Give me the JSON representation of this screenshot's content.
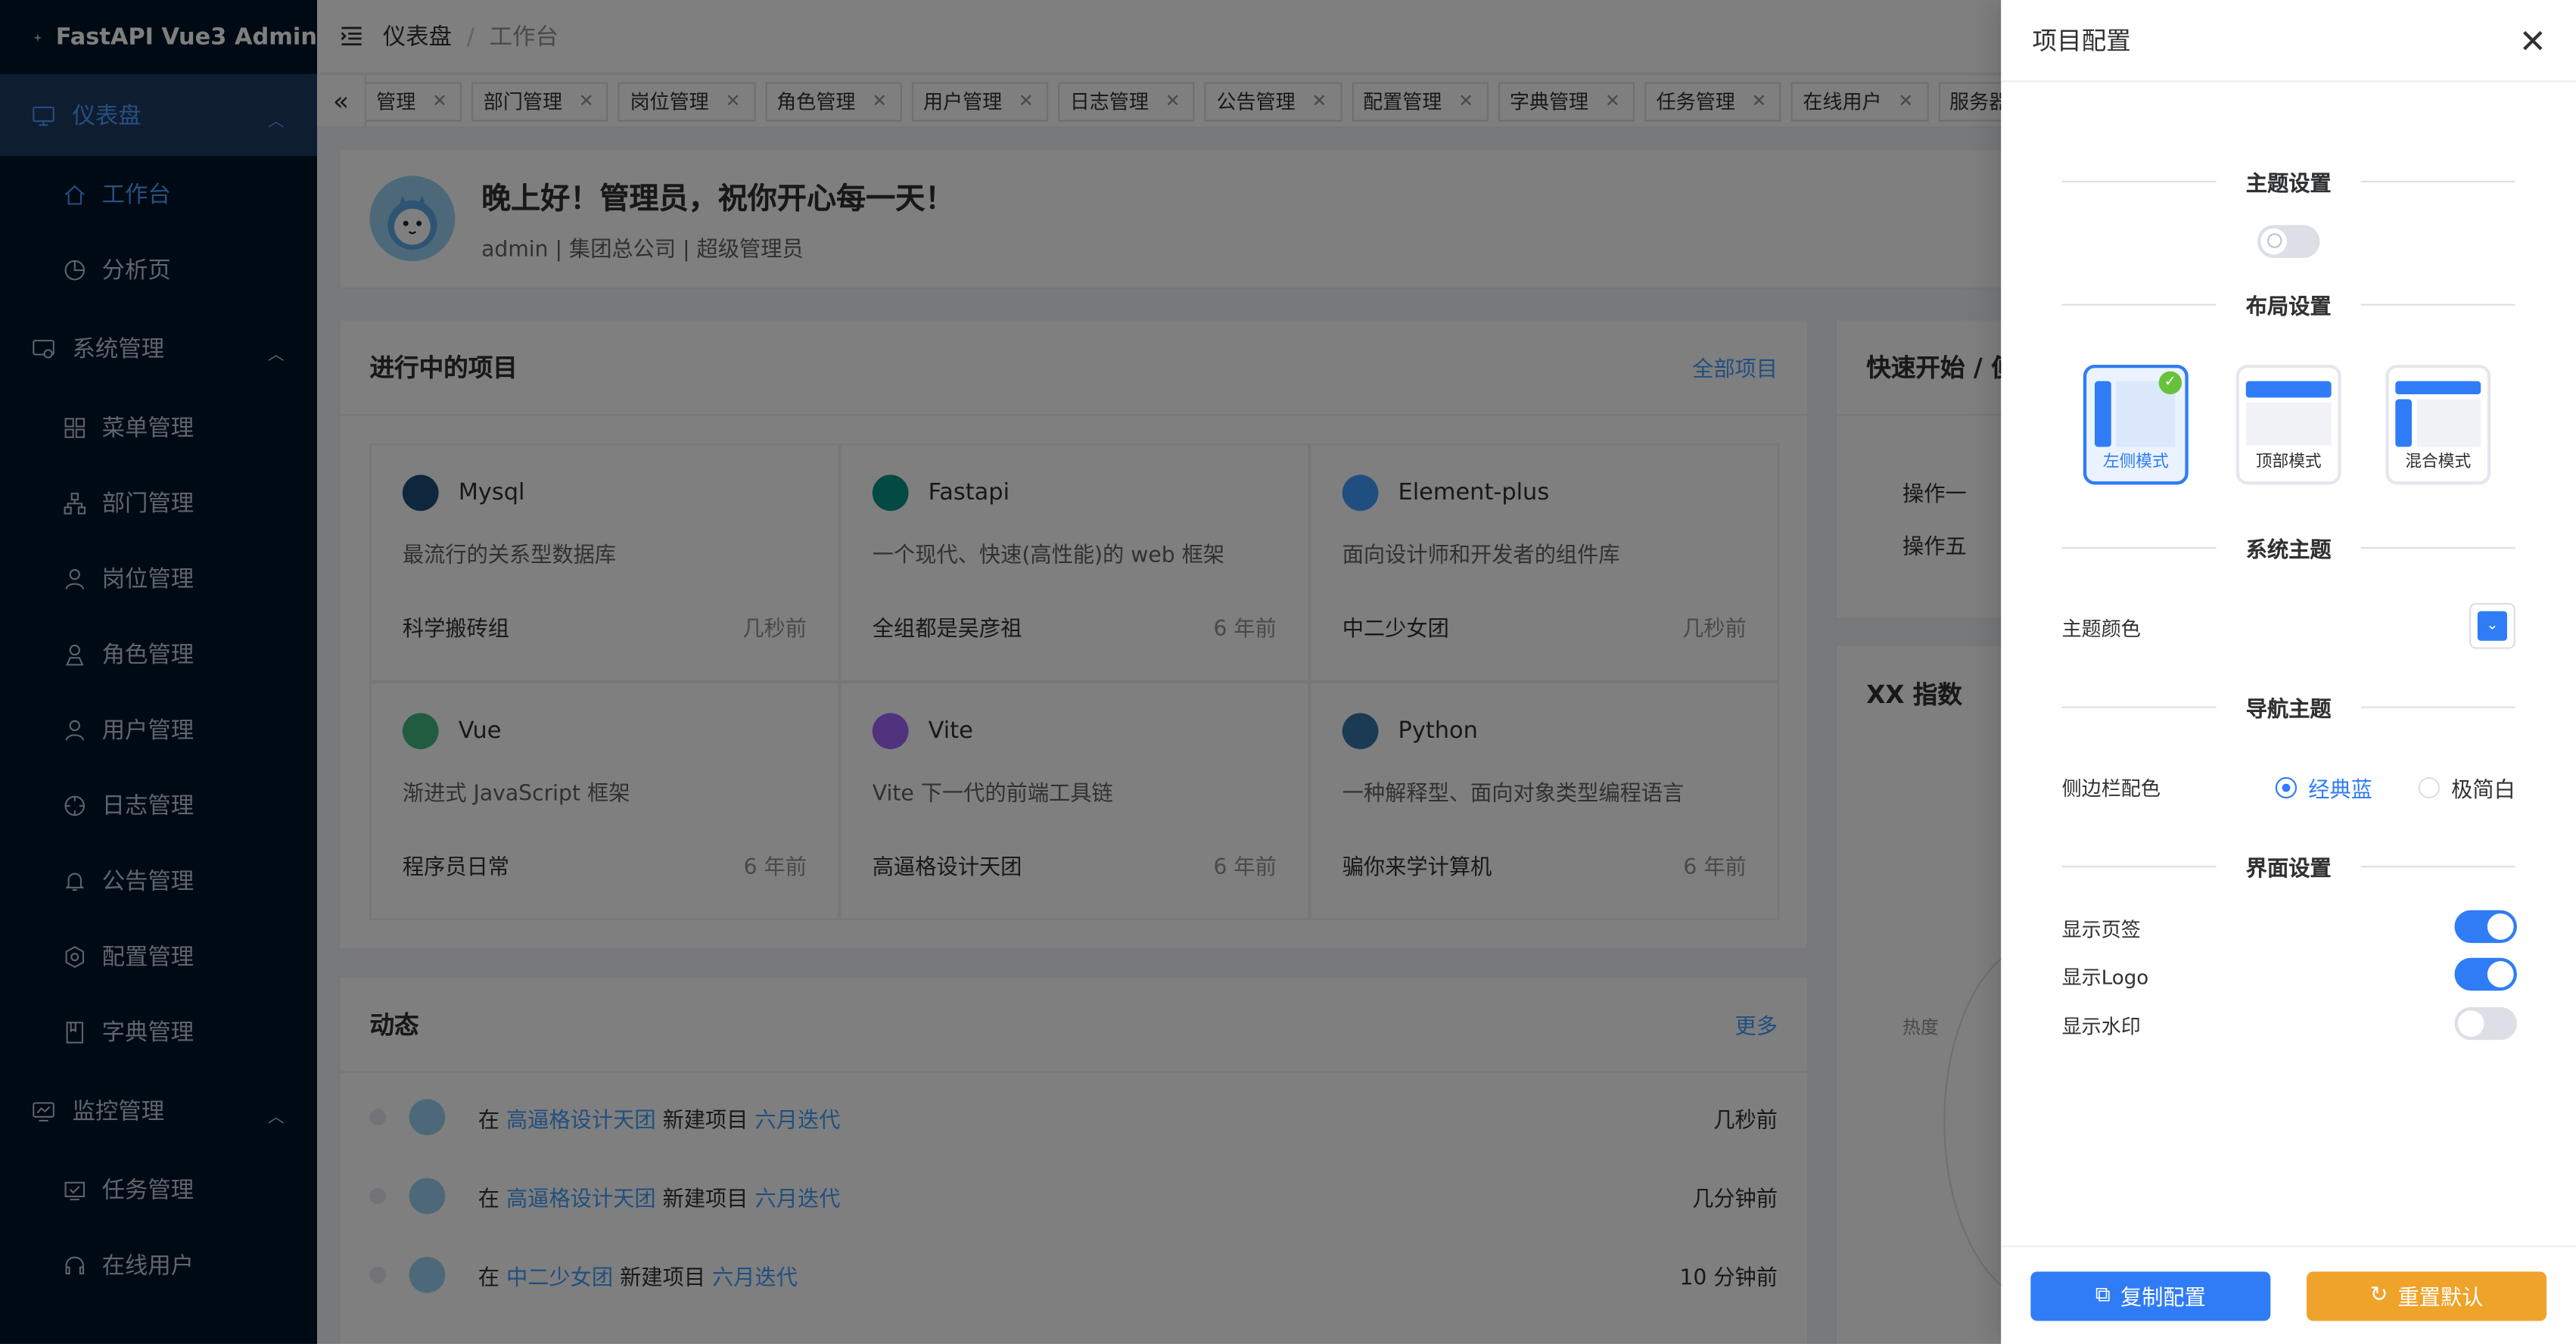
{
  "app": {
    "title": "FastAPI Vue3 Admin"
  },
  "sidebar": {
    "groups": [
      {
        "label": "仪表盘",
        "items": [
          {
            "label": "工作台"
          },
          {
            "label": "分析页"
          }
        ]
      },
      {
        "label": "系统管理",
        "items": [
          {
            "label": "菜单管理"
          },
          {
            "label": "部门管理"
          },
          {
            "label": "岗位管理"
          },
          {
            "label": "角色管理"
          },
          {
            "label": "用户管理"
          },
          {
            "label": "日志管理"
          },
          {
            "label": "公告管理"
          },
          {
            "label": "配置管理"
          },
          {
            "label": "字典管理"
          }
        ]
      },
      {
        "label": "监控管理",
        "items": [
          {
            "label": "任务管理"
          },
          {
            "label": "在线用户"
          }
        ]
      }
    ]
  },
  "navbar": {
    "breadcrumb": [
      "仪表盘",
      "工作台"
    ],
    "separator": "/"
  },
  "tags": [
    "管理",
    "部门管理",
    "岗位管理",
    "角色管理",
    "用户管理",
    "日志管理",
    "公告管理",
    "配置管理",
    "字典管理",
    "任务管理",
    "在线用户",
    "服务器监控"
  ],
  "welcome": {
    "title": "晚上好！管理员，祝你开心每一天！",
    "subtitle": "admin | 集团总公司 | 超级管理员"
  },
  "projects": {
    "title": "进行中的项目",
    "link": "全部项目",
    "items": [
      {
        "name": "Mysql",
        "desc": "最流行的关系型数据库",
        "team": "科学搬砖组",
        "time": "几秒前",
        "color": "#1f4e79"
      },
      {
        "name": "Fastapi",
        "desc": "一个现代、快速(高性能)的 web 框架",
        "team": "全组都是吴彦祖",
        "time": "6 年前",
        "color": "#059487"
      },
      {
        "name": "Element-plus",
        "desc": "面向设计师和开发者的组件库",
        "team": "中二少女团",
        "time": "几秒前",
        "color": "#409eff"
      },
      {
        "name": "Vue",
        "desc": "渐进式 JavaScript 框架",
        "team": "程序员日常",
        "time": "6 年前",
        "color": "#42b883"
      },
      {
        "name": "Vite",
        "desc": "Vite 下一代的前端工具链",
        "team": "高逼格设计天团",
        "time": "6 年前",
        "color": "#a364fe"
      },
      {
        "name": "Python",
        "desc": "一种解释型、面向对象类型编程语言",
        "team": "骗你来学计算机",
        "time": "6 年前",
        "color": "#3776ab"
      }
    ]
  },
  "activity": {
    "title": "动态",
    "link": "更多",
    "items": [
      {
        "pre": "在",
        "team": "高逼格设计天团",
        "mid": "新建项目",
        "project": "六月迭代",
        "time": "几秒前"
      },
      {
        "pre": "在",
        "team": "高逼格设计天团",
        "mid": "新建项目",
        "project": "六月迭代",
        "time": "几分钟前"
      },
      {
        "pre": "在",
        "team": "中二少女团",
        "mid": "新建项目",
        "project": "六月迭代",
        "time": "10 分钟前"
      }
    ]
  },
  "quick": {
    "title": "快速开始 / 便",
    "items": [
      "操作一",
      "操作五"
    ]
  },
  "index_card": {
    "title": "XX 指数",
    "label": "热度"
  },
  "drawer": {
    "title": "项目配置",
    "theme_section": "主题设置",
    "layout_section": "布局设置",
    "layouts": [
      "左侧模式",
      "顶部模式",
      "混合模式"
    ],
    "system_theme_section": "系统主题",
    "theme_color_label": "主题颜色",
    "theme_color": "#2f7cf6",
    "nav_theme_section": "导航主题",
    "sidebar_color_label": "侧边栏配色",
    "sidebar_options": [
      "经典蓝",
      "极简白"
    ],
    "ui_section": "界面设置",
    "toggles": [
      {
        "label": "显示页签",
        "on": true
      },
      {
        "label": "显示Logo",
        "on": true
      },
      {
        "label": "显示水印",
        "on": false
      }
    ],
    "copy_button": "复制配置",
    "reset_button": "重置默认"
  }
}
